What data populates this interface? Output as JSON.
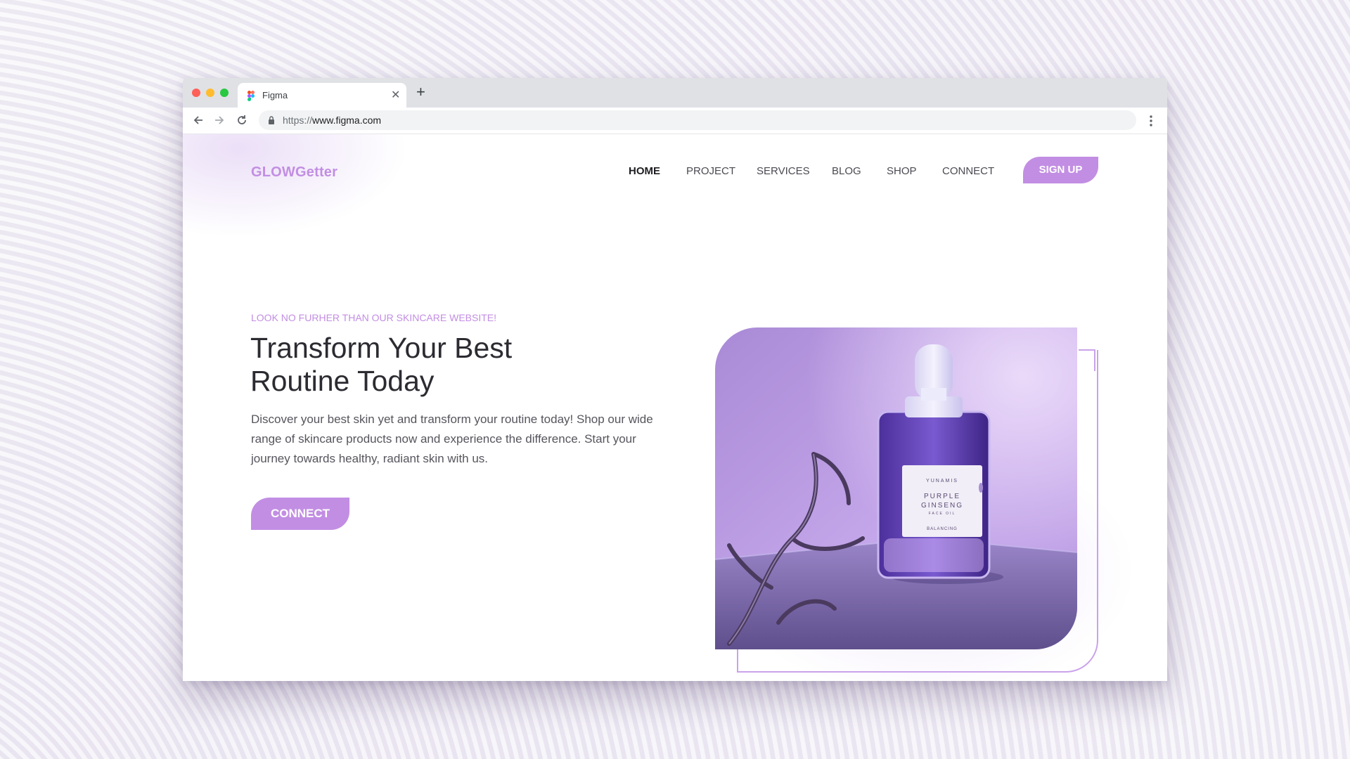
{
  "browser": {
    "tab_title": "Figma",
    "url_scheme": "https://",
    "url_host": "www.figma.com",
    "icons": [
      "figma-favicon",
      "close-icon",
      "plus-icon",
      "back-arrow-icon",
      "forward-arrow-icon",
      "reload-icon",
      "lock-icon",
      "kebab-menu-icon"
    ]
  },
  "site": {
    "logo": "GLOWGetter",
    "nav": [
      "HOME",
      "PROJECT",
      "SERVICES",
      "BLOG",
      "SHOP",
      "CONNECT"
    ],
    "active_nav": "HOME",
    "signup_label": "SIGN UP"
  },
  "hero": {
    "eyebrow": "LOOK NO FURHER THAN OUR SKINCARE WEBSITE!",
    "headline_line1": "Transform Your Best",
    "headline_line2": "Routine Today",
    "description": "Discover your best skin yet and transform your routine today! Shop our wide range of skincare products now and experience the difference. Start your journey towards healthy, radiant skin with us.",
    "cta_label": "CONNECT",
    "product": {
      "brand": "YUNAMIS",
      "name_line1": "PURPLE",
      "name_line2": "GINSENG",
      "type": "FACE OIL",
      "variant": "BALANCING"
    }
  },
  "colors": {
    "accent": "#c28ee3",
    "frame": "#c9a2ea",
    "text_dark": "#2b2b31",
    "text_body": "#55555d"
  }
}
